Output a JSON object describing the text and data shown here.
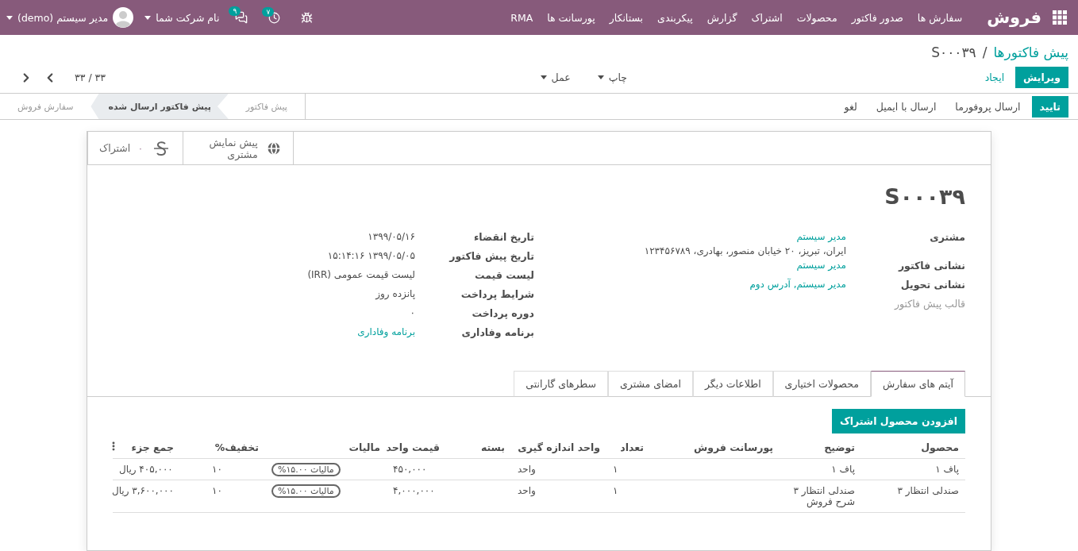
{
  "navbar": {
    "app": "فروش",
    "menu": [
      "سفارش ها",
      "صدور فاکتور",
      "محصولات",
      "اشتراک",
      "گزارش",
      "پیکربندی",
      "بستانکار",
      "پورسانت ها",
      "RMA"
    ],
    "activity_count": "۷",
    "message_count": "۹",
    "company": "نام شرکت شما",
    "user": "مدیر سیستم (demo)"
  },
  "breadcrumb": {
    "parent": "پیش فاکتورها",
    "separator": "/",
    "current": "S۰۰۰۳۹"
  },
  "actions": {
    "buttons": [
      {
        "label": "ویرایش",
        "kind": "primary"
      },
      {
        "label": "ایجاد",
        "kind": "link"
      }
    ],
    "dropdowns": [
      "چاپ",
      "عمل"
    ],
    "pager": "۳۳ / ۳۳"
  },
  "statusbar": {
    "buttons": [
      {
        "label": "تایید",
        "kind": "primary"
      },
      {
        "label": "ارسال پروفورما",
        "kind": "plain"
      },
      {
        "label": "ارسال با ایمیل",
        "kind": "plain"
      },
      {
        "label": "لغو",
        "kind": "plain"
      }
    ],
    "stages": [
      {
        "label": "پیش فاکتور",
        "selected": false
      },
      {
        "label": "پیش فاکتور ارسال شده",
        "selected": true
      },
      {
        "label": "سفارش فروش",
        "selected": false
      }
    ]
  },
  "button_box": [
    {
      "kind": "preview",
      "label": "پیش نمایش مشتری"
    },
    {
      "kind": "subscription",
      "label": "اشتراک",
      "count": "۰"
    }
  ],
  "title": "S۰۰۰۳۹",
  "groups": [
    [
      {
        "label": "مشتری",
        "values": [
          {
            "text": "مدیر سیستم",
            "kind": "link"
          },
          {
            "text": "ایران، تبریز، ۲۰ خیابان منصور، بهادری، ۱۲۳۴۵۶۷۸۹",
            "kind": "text"
          }
        ]
      },
      {
        "label": "نشانی فاکتور",
        "values": [
          {
            "text": "مدیر سیستم",
            "kind": "link"
          }
        ]
      },
      {
        "label": "نشانی تحویل",
        "values": [
          {
            "text": "مدیر سیستم, آدرس دوم",
            "kind": "link"
          }
        ]
      },
      {
        "label": "قالب پیش فاکتور",
        "empty": true
      }
    ],
    [
      {
        "label": "تاریخ انقضاء",
        "values": [
          {
            "text": "۱۳۹۹/۰۵/۱۶",
            "kind": "text"
          }
        ]
      },
      {
        "label": "تاریخ پیش فاکتور",
        "values": [
          {
            "text": "۱۳۹۹/۰۵/۰۵ ۱۵:۱۴:۱۶",
            "kind": "text"
          }
        ]
      },
      {
        "label": "لیست قیمت",
        "values": [
          {
            "text": "لیست قیمت عمومی (IRR)",
            "kind": "text"
          }
        ]
      },
      {
        "label": "شرایط پرداخت",
        "values": [
          {
            "text": "پانزده روز",
            "kind": "text"
          }
        ]
      },
      {
        "label": "دوره پرداخت",
        "values": [
          {
            "text": "۰",
            "kind": "text"
          }
        ]
      },
      {
        "label": "برنامه وفاداری",
        "values": [
          {
            "text": "برنامه وفاداری",
            "kind": "link"
          }
        ]
      }
    ]
  ],
  "tabs": [
    {
      "label": "آیتم های سفارش",
      "selected": true
    },
    {
      "label": "محصولات اختیاری",
      "selected": false
    },
    {
      "label": "اطلاعات دیگر",
      "selected": false
    },
    {
      "label": "امضای مشتری",
      "selected": false
    },
    {
      "label": "سطرهای گارانتی",
      "selected": false
    }
  ],
  "add_button": "افزودن محصول اشتراک",
  "table": {
    "columns": [
      "محصول",
      "توضیح",
      "پورسانت فروش",
      "تعداد",
      "واحد اندازه گیری",
      "بسته",
      "قیمت واحد",
      "مالیات",
      "تخفیف%",
      "جمع جزء"
    ],
    "rows": [
      {
        "product": "پاف ۱",
        "description": [
          "پاف ۱"
        ],
        "quantity": "۱",
        "uom": "واحد",
        "unit_price": "۴۵۰,۰۰۰",
        "tax": "مالیات ۱۵.۰۰%",
        "discount": "۱۰",
        "subtotal": "۴۰۵,۰۰۰ ریال"
      },
      {
        "product": "صندلی انتظار ۳",
        "description": [
          "صندلی انتظار ۳",
          "شرح فروش"
        ],
        "quantity": "۱",
        "uom": "واحد",
        "unit_price": "۴,۰۰۰,۰۰۰",
        "tax": "مالیات ۱۵.۰۰%",
        "discount": "۱۰",
        "subtotal": "۳,۶۰۰,۰۰۰ ریال"
      }
    ]
  }
}
